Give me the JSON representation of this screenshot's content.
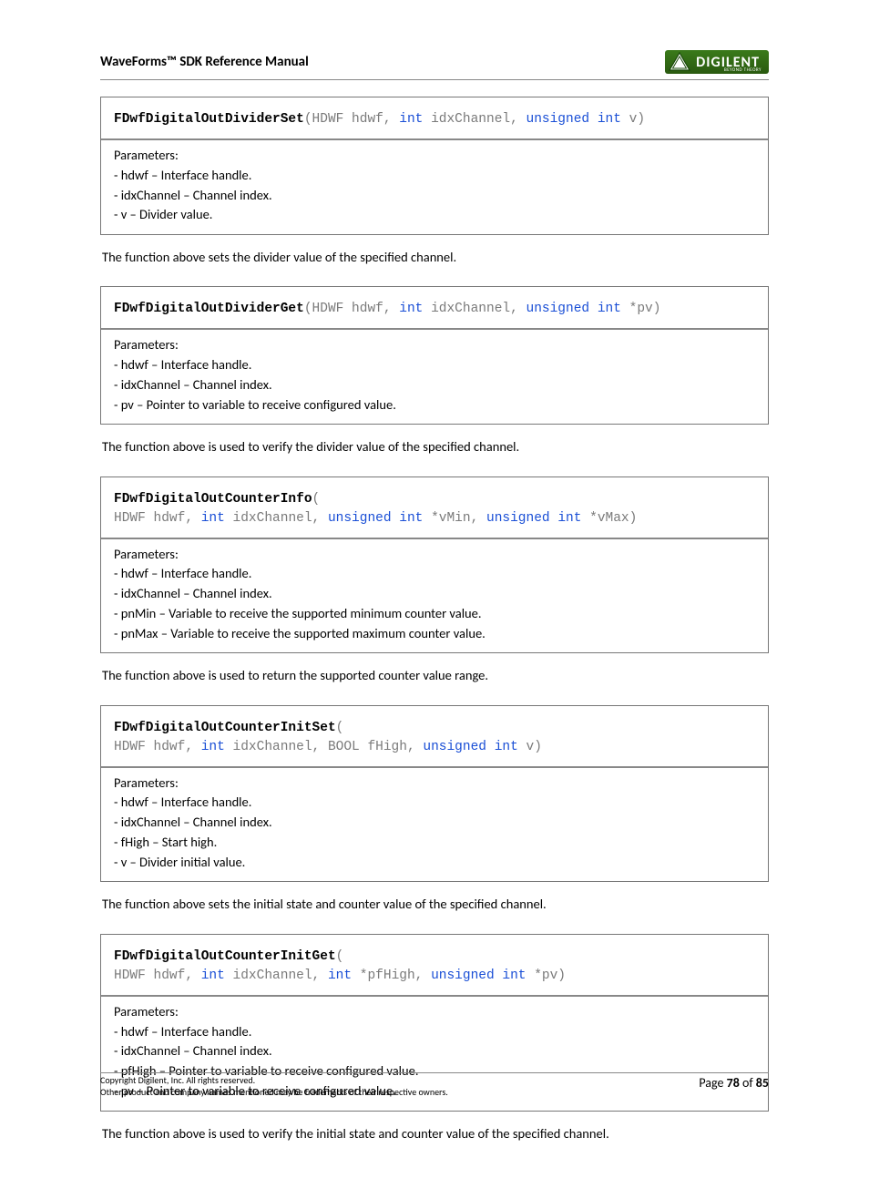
{
  "header": {
    "title": "WaveForms™ SDK Reference Manual",
    "logo_text": "DIGILENT",
    "logo_sub": "BEYOND THEORY"
  },
  "functions": [
    {
      "name": "FDwfDigitalOutDividerSet",
      "sig_parts": [
        "(HDWF hdwf, ",
        "int",
        " idxChannel, ",
        "unsigned int",
        " v)"
      ],
      "params_label": "Parameters:",
      "params": [
        "- hdwf – Interface handle.",
        "- idxChannel – Channel index.",
        "- v – Divider value."
      ],
      "desc": "The function above sets the divider value of the specified channel."
    },
    {
      "name": "FDwfDigitalOutDividerGet",
      "sig_parts": [
        "(HDWF hdwf, ",
        "int",
        " idxChannel, ",
        "unsigned int",
        " *pv)"
      ],
      "params_label": "Parameters:",
      "params": [
        "- hdwf – Interface handle.",
        "- idxChannel – Channel index.",
        "- pv – Pointer to variable to receive configured value."
      ],
      "desc": "The function above is used to verify the divider value of the specified channel."
    },
    {
      "name": "FDwfDigitalOutCounterInfo",
      "sig_parts": [
        "(\nHDWF hdwf, ",
        "int",
        " idxChannel, ",
        "unsigned int",
        " *vMin, ",
        "unsigned int",
        " *vMax)"
      ],
      "params_label": "Parameters:",
      "params": [
        "- hdwf – Interface handle.",
        "- idxChannel – Channel index.",
        "- pnMin – Variable to receive the supported minimum counter value.",
        "- pnMax – Variable to receive the supported maximum counter value."
      ],
      "desc": "The function above is used to return the supported counter value range."
    },
    {
      "name": "FDwfDigitalOutCounterInitSet",
      "sig_parts": [
        "(\nHDWF hdwf, ",
        "int",
        " idxChannel, BOOL fHigh, ",
        "unsigned int",
        " v)"
      ],
      "params_label": "Parameters:",
      "params": [
        "- hdwf – Interface handle.",
        "- idxChannel – Channel index.",
        "- fHigh – Start high.",
        "- v – Divider initial value."
      ],
      "desc": "The function above sets the initial state and counter value of the specified channel."
    },
    {
      "name": "FDwfDigitalOutCounterInitGet",
      "sig_parts": [
        "(\nHDWF hdwf, ",
        "int",
        " idxChannel, ",
        "int",
        " *pfHigh, ",
        "unsigned int",
        " *pv)"
      ],
      "params_label": "Parameters:",
      "params": [
        "- hdwf – Interface handle.",
        "- idxChannel – Channel index.",
        "- pfHigh – Pointer to variable to receive configured value.",
        "- pv – Pointer to variable to receive configured value."
      ],
      "desc": "The function above is used to verify the initial state and counter value of the specified channel."
    }
  ],
  "footer": {
    "copyright": "Copyright Digilent, Inc. All rights reserved.",
    "trademark": "Other product and company names mentioned may be trademarks of their respective owners.",
    "page_prefix": "Page ",
    "page_num": "78",
    "page_of": " of ",
    "page_total": "85"
  }
}
